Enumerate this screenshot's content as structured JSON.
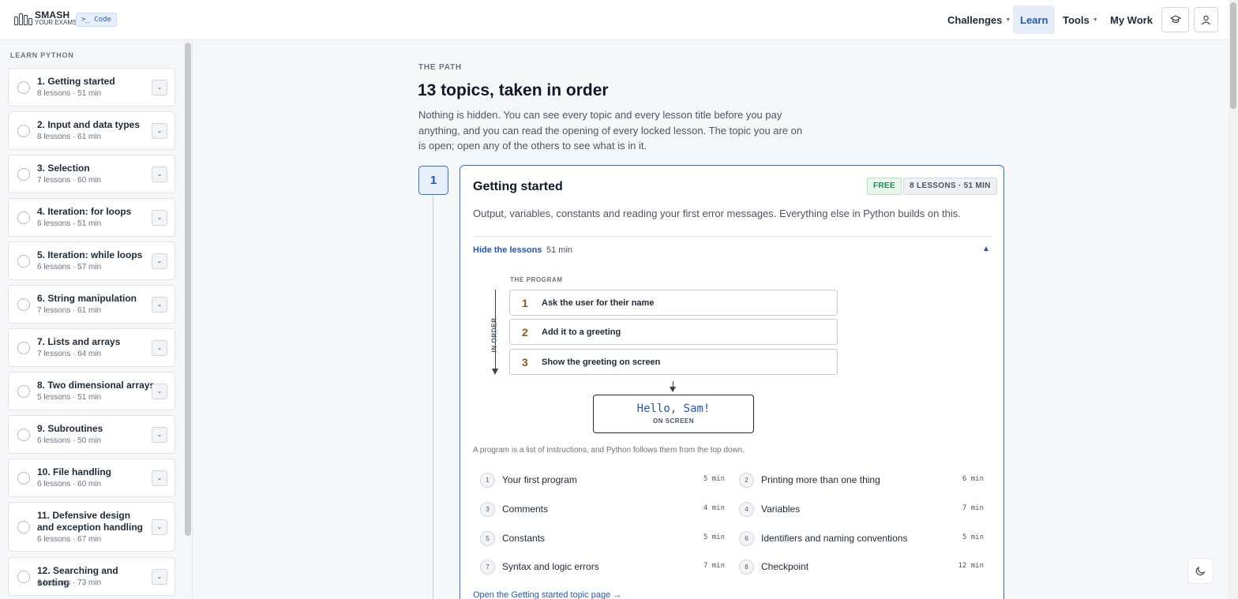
{
  "header": {
    "logo_line1": "SMASH",
    "logo_line2": "YOUR EXAMS",
    "code_badge": ">_ Code",
    "nav": {
      "challenges": "Challenges",
      "learn": "Learn",
      "tools": "Tools",
      "my_work": "My Work"
    },
    "icons": [
      "graduation-cap-icon",
      "user-icon"
    ]
  },
  "sidebar": {
    "title": "LEARN PYTHON",
    "topics": [
      {
        "title": "1. Getting started",
        "meta": "8 lessons · 51 min"
      },
      {
        "title": "2. Input and data types",
        "meta": "8 lessons · 61 min"
      },
      {
        "title": "3. Selection",
        "meta": "7 lessons · 60 min"
      },
      {
        "title": "4. Iteration: for loops",
        "meta": "6 lessons · 51 min"
      },
      {
        "title": "5. Iteration: while loops",
        "meta": "6 lessons · 57 min"
      },
      {
        "title": "6. String manipulation",
        "meta": "7 lessons · 61 min"
      },
      {
        "title": "7. Lists and arrays",
        "meta": "7 lessons · 64 min"
      },
      {
        "title": "8. Two dimensional arrays",
        "meta": "5 lessons · 51 min"
      },
      {
        "title": "9. Subroutines",
        "meta": "6 lessons · 50 min"
      },
      {
        "title": "10. File handling",
        "meta": "6 lessons · 60 min"
      },
      {
        "title": "11. Defensive design and exception handling",
        "meta": "6 lessons · 67 min"
      },
      {
        "title": "12. Searching and sorting",
        "meta": "6 lessons · 73 min"
      }
    ]
  },
  "main": {
    "eyebrow": "THE PATH",
    "title": "13 topics, taken in order",
    "intro": "Nothing is hidden. You can see every topic and every lesson title before you pay anything, and you can read the opening of every locked lesson. The topic you are on is open; open any of the others to see what is in it.",
    "step_number": "1",
    "topic": {
      "title": "Getting started",
      "badge_free": "FREE",
      "badge_lessons": "8 LESSONS · 51 MIN",
      "description": "Output, variables, constants and reading your first error messages. Everything else in Python builds on this.",
      "hide_link": "Hide the lessons",
      "hide_duration": "51 min",
      "diagram": {
        "program_label": "THE PROGRAM",
        "order_label": "IN ORDER",
        "steps": [
          {
            "num": "1",
            "label": "Ask the user for their name"
          },
          {
            "num": "2",
            "label": "Add it to a greeting"
          },
          {
            "num": "3",
            "label": "Show the greeting on screen"
          }
        ],
        "screen_text": "Hello, Sam!",
        "screen_label": "ON SCREEN"
      },
      "caption": "A program is a list of instructions, and Python follows them from the top down.",
      "lessons": [
        {
          "num": "1",
          "title": "Your first program",
          "duration": "5 min"
        },
        {
          "num": "2",
          "title": "Printing more than one thing",
          "duration": "6 min"
        },
        {
          "num": "3",
          "title": "Comments",
          "duration": "4 min"
        },
        {
          "num": "4",
          "title": "Variables",
          "duration": "7 min"
        },
        {
          "num": "5",
          "title": "Constants",
          "duration": "5 min"
        },
        {
          "num": "6",
          "title": "Identifiers and naming conventions",
          "duration": "5 min"
        },
        {
          "num": "7",
          "title": "Syntax and logic errors",
          "duration": "7 min"
        },
        {
          "num": "8",
          "title": "Checkpoint",
          "duration": "12 min"
        }
      ],
      "open_link": "Open the Getting started topic page →"
    }
  },
  "colors": {
    "accent": "#2456b8",
    "free_green": "#1e8a4c",
    "step_number_brown": "#8a5a12"
  }
}
